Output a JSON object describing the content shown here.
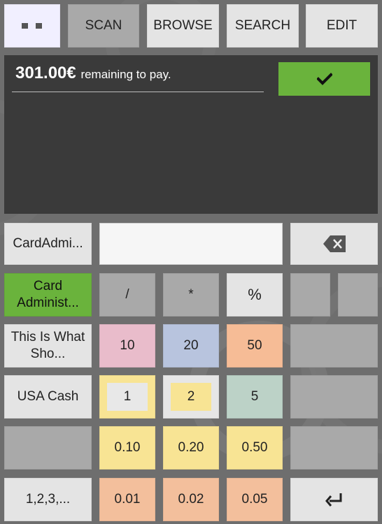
{
  "toolbar": {
    "menu_icon": "dots-menu-icon",
    "scan": "SCAN",
    "browse": "BROWSE",
    "search": "SEARCH",
    "edit": "EDIT"
  },
  "ticket": {
    "amount": "301.00€",
    "amount_note": "remaining to pay.",
    "confirm_icon": "checkmark-icon"
  },
  "payment_methods": [
    {
      "label": "CardAdmi...",
      "state": "normal"
    },
    {
      "label": "Card Administ...",
      "state": "selected"
    },
    {
      "label": "This Is What Sho...",
      "state": "normal"
    },
    {
      "label": "USA Cash",
      "state": "normal"
    },
    {
      "label": "",
      "state": "empty"
    },
    {
      "label": "1,2,3,...",
      "state": "normal"
    }
  ],
  "amount_input": {
    "value": ""
  },
  "keypad": {
    "backspace_icon": "backspace-icon",
    "enter_icon": "enter-icon",
    "operators": [
      "/",
      "*",
      "%"
    ],
    "row_notes": [
      "10",
      "20",
      "50"
    ],
    "row_small": [
      "1",
      "2",
      "5"
    ],
    "row_coins_high": [
      "0.10",
      "0.20",
      "0.50"
    ],
    "row_coins_low": [
      "0.01",
      "0.02",
      "0.05"
    ]
  },
  "colors": {
    "background": "#6e6e6e",
    "ticket_panel": "#3a3a3a",
    "accent_green": "#6ab33c",
    "note_10": "#e9bccb",
    "note_20": "#b8c4de",
    "note_50": "#f6bc96",
    "coin_5": "#bcd2c7",
    "coin_yellow": "#f8e494",
    "coin_copper": "#f3bf9c"
  }
}
